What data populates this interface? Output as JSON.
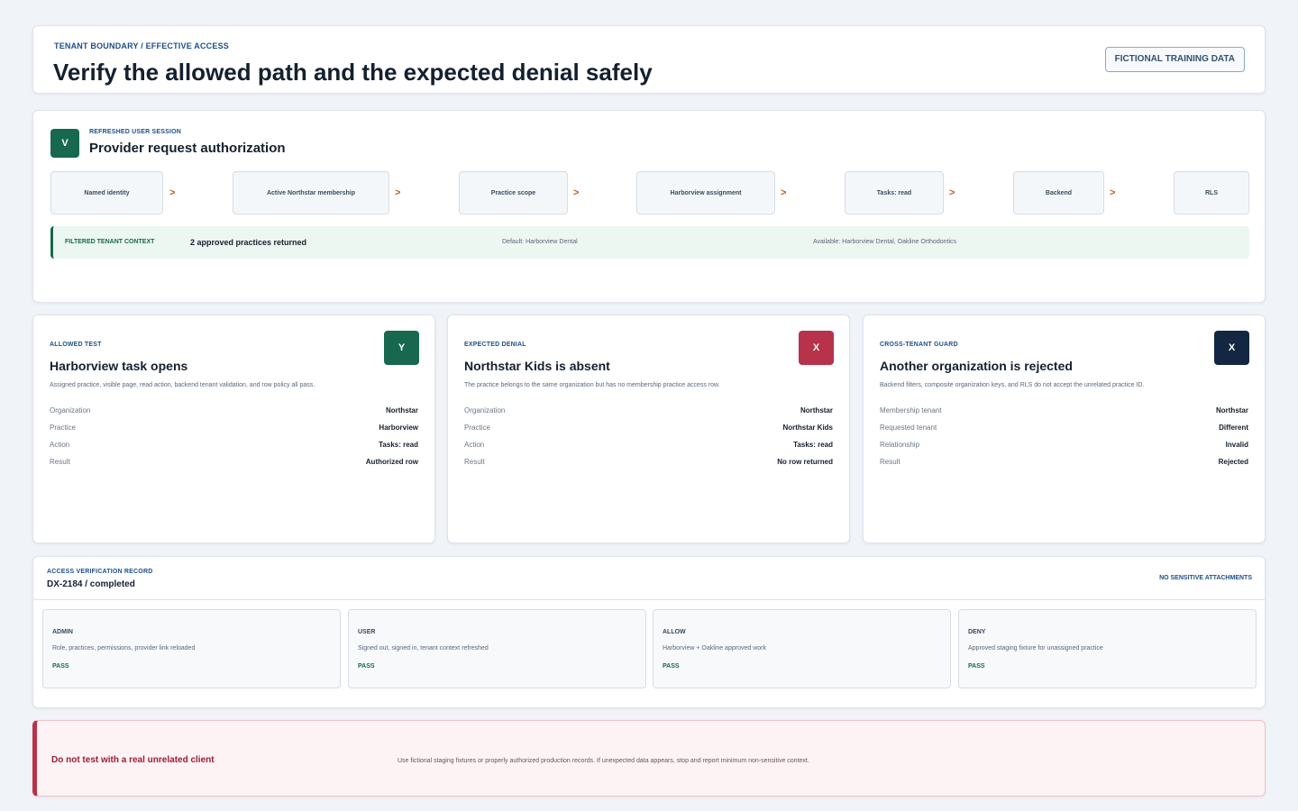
{
  "header": {
    "eyebrow": "TENANT BOUNDARY / EFFECTIVE ACCESS",
    "title": "Verify the allowed path and the expected denial safely",
    "badge": "FICTIONAL TRAINING DATA"
  },
  "session": {
    "icon_glyph": "V",
    "icon_name": "check-icon",
    "eyebrow": "REFRESHED USER SESSION",
    "title": "Provider request authorization",
    "chain": [
      {
        "label": "Named identity"
      },
      {
        "label": "Active Northstar membership"
      },
      {
        "label": "Practice scope"
      },
      {
        "label": "Harborview assignment"
      },
      {
        "label": "Tasks: read"
      },
      {
        "label": "Backend"
      },
      {
        "label": "RLS"
      }
    ],
    "arrow": ">",
    "context": {
      "label": "FILTERED TENANT CONTEXT",
      "value": "2 approved practices returned",
      "default": "Default: Harborview Dental",
      "available": "Available: Harborview Dental, Oakline Orthodontics"
    }
  },
  "tests": [
    {
      "eyebrow": "ALLOWED TEST",
      "title": "Harborview task opens",
      "description": "Assigned practice, visible page, read action, backend tenant validation, and row policy all pass.",
      "icon_glyph": "Y",
      "icon_name": "allow-icon",
      "icon_color": "#17684f",
      "rows": [
        {
          "key": "Organization",
          "value": "Northstar"
        },
        {
          "key": "Practice",
          "value": "Harborview"
        },
        {
          "key": "Action",
          "value": "Tasks: read"
        },
        {
          "key": "Result",
          "value": "Authorized row"
        }
      ]
    },
    {
      "eyebrow": "EXPECTED DENIAL",
      "title": "Northstar Kids is absent",
      "description": "The practice belongs to the same organization but has no membership practice access row.",
      "icon_glyph": "X",
      "icon_name": "deny-icon",
      "icon_color": "#b8324b",
      "rows": [
        {
          "key": "Organization",
          "value": "Northstar"
        },
        {
          "key": "Practice",
          "value": "Northstar Kids"
        },
        {
          "key": "Action",
          "value": "Tasks: read"
        },
        {
          "key": "Result",
          "value": "No row returned"
        }
      ]
    },
    {
      "eyebrow": "CROSS-TENANT GUARD",
      "title": "Another organization is rejected",
      "description": "Backend filters, composite organization keys, and RLS do not accept the unrelated practice ID.",
      "icon_glyph": "X",
      "icon_name": "reject-icon",
      "icon_color": "#132743",
      "rows": [
        {
          "key": "Membership tenant",
          "value": "Northstar"
        },
        {
          "key": "Requested tenant",
          "value": "Different"
        },
        {
          "key": "Relationship",
          "value": "Invalid"
        },
        {
          "key": "Result",
          "value": "Rejected"
        }
      ]
    }
  ],
  "record": {
    "eyebrow": "ACCESS VERIFICATION RECORD",
    "id": "DX-2184 / completed",
    "attachments": "NO SENSITIVE ATTACHMENTS",
    "checks": [
      {
        "title": "ADMIN",
        "description": "Role, practices, permissions, provider link reloaded",
        "status": "PASS"
      },
      {
        "title": "USER",
        "description": "Signed out, signed in, tenant context refreshed",
        "status": "PASS"
      },
      {
        "title": "ALLOW",
        "description": "Harborview + Oakline approved work",
        "status": "PASS"
      },
      {
        "title": "DENY",
        "description": "Approved staging fixture for unassigned practice",
        "status": "PASS"
      }
    ]
  },
  "warning": {
    "title": "Do not test with a real unrelated client",
    "text": "Use fictional staging fixtures or properly authorized production records. If unexpected data appears, stop and report minimum non-sensitive context."
  }
}
